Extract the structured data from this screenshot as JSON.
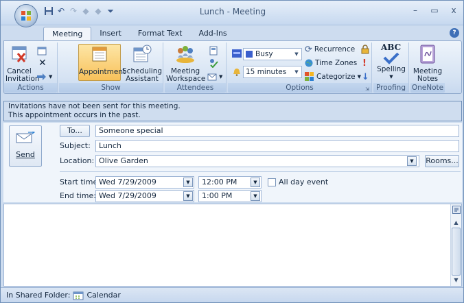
{
  "window": {
    "title": "Lunch - Meeting",
    "minimize_glyph": "–",
    "maximize_glyph": "▭",
    "close_glyph": "x"
  },
  "quick_access": {
    "items": [
      "save-icon",
      "undo-icon",
      "redo-icon",
      "previous-icon",
      "next-icon",
      "customize-icon"
    ]
  },
  "tabs": [
    {
      "label": "Meeting",
      "active": true
    },
    {
      "label": "Insert",
      "active": false
    },
    {
      "label": "Format Text",
      "active": false
    },
    {
      "label": "Add-Ins",
      "active": false
    }
  ],
  "help_glyph": "?",
  "ribbon": {
    "actions": {
      "group_label": "Actions",
      "cancel_label_1": "Cancel",
      "cancel_label_2": "Invitation"
    },
    "show": {
      "group_label": "Show",
      "appointment_label": "Appointment",
      "scheduling_label_1": "Scheduling",
      "scheduling_label_2": "Assistant"
    },
    "attendees": {
      "group_label": "Attendees",
      "workspace_label_1": "Meeting",
      "workspace_label_2": "Workspace"
    },
    "options": {
      "group_label": "Options",
      "show_as_value": "Busy",
      "reminder_value": "15 minutes",
      "recurrence_label": "Recurrence",
      "timezones_label": "Time Zones",
      "categorize_label": "Categorize"
    },
    "proofing": {
      "group_label": "Proofing",
      "spelling_label": "Spelling",
      "abc_text": "ABC"
    },
    "onenote": {
      "group_label": "OneNote",
      "notes_label_1": "Meeting",
      "notes_label_2": "Notes"
    }
  },
  "info": {
    "line1": "Invitations have not been sent for this meeting.",
    "line2": "This appointment occurs in the past."
  },
  "form": {
    "send_label": "Send",
    "to_button": "To...",
    "to_value": "Someone special",
    "subject_label": "Subject:",
    "subject_value": "Lunch",
    "location_label": "Location:",
    "location_value": "Olive Garden",
    "rooms_button": "Rooms...",
    "start_label": "Start time:",
    "start_date": "Wed 7/29/2009",
    "start_time": "12:00 PM",
    "all_day_label": "All day event",
    "all_day_checked": false,
    "end_label": "End time:",
    "end_date": "Wed 7/29/2009",
    "end_time": "1:00 PM"
  },
  "body_text": "",
  "status": {
    "prefix": "In Shared Folder:",
    "folder": "Calendar"
  },
  "colors": {
    "accent": "#3e6fb7",
    "busy": "#3a5fcd",
    "active_button": "#f8c15a"
  }
}
